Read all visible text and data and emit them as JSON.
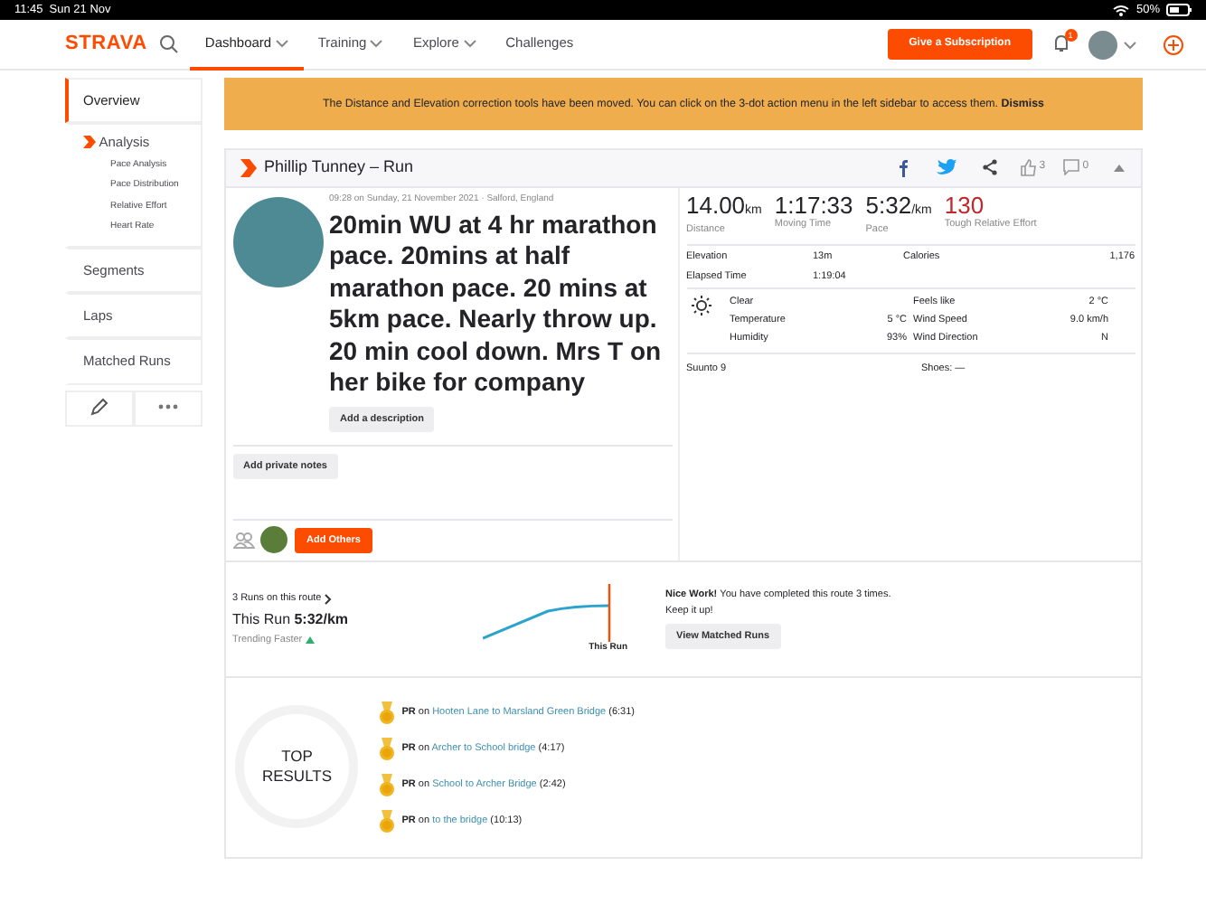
{
  "status_bar": {
    "time": "11:45",
    "date": "Sun 21 Nov",
    "battery": "50%"
  },
  "navbar": {
    "logo": "STRAVA",
    "tabs": [
      {
        "label": "Dashboard",
        "selected": true,
        "dropdown": true
      },
      {
        "label": "Training",
        "selected": false,
        "dropdown": true
      },
      {
        "label": "Explore",
        "selected": false,
        "dropdown": true
      },
      {
        "label": "Challenges",
        "selected": false,
        "dropdown": false
      }
    ],
    "subscribe_button": "Give a Subscription",
    "notification_count": "1"
  },
  "sidebar": {
    "items": [
      {
        "label": "Overview",
        "selected": true
      },
      {
        "label": "Analysis",
        "selected": false,
        "expanded": true,
        "children": [
          {
            "label": "Pace Analysis"
          },
          {
            "label": "Pace Distribution"
          },
          {
            "label": "Relative Effort"
          },
          {
            "label": "Heart Rate"
          }
        ]
      },
      {
        "label": "Segments",
        "selected": false
      },
      {
        "label": "Laps",
        "selected": false
      },
      {
        "label": "Matched Runs",
        "selected": false
      }
    ]
  },
  "banner": {
    "message": "The Distance and Elevation correction tools have been moved. You can click on the 3-dot action menu in the left sidebar to access them.",
    "action": "Dismiss"
  },
  "activity": {
    "title": "Phillip Tunney – Run",
    "kudos": "3",
    "comments": "0",
    "meta": "09:28 on Sunday, 21 November 2021 · Salford, England",
    "name": "20min WU at 4 hr marathon pace. 20mins at half marathon pace. 20 mins at 5km pace. Nearly throw up. 20 min cool down. Mrs T on her bike for company",
    "description_button": "Add a description",
    "notes_button": "Add private notes",
    "add_others_button": "Add Others",
    "stats": [
      {
        "value": "14.00",
        "unit": "km",
        "label": "Distance",
        "emphasis": false
      },
      {
        "value": "1:17:33",
        "label": "Moving Time",
        "emphasis": false
      },
      {
        "value": "5:32",
        "unit": "/km",
        "label": "Pace",
        "emphasis": false
      },
      {
        "value": "130",
        "label": "Tough Relative Effort",
        "emphasis": true
      }
    ],
    "details": [
      {
        "label": "Elevation",
        "value": "13m"
      },
      {
        "label": "Calories",
        "value": "1,176"
      },
      {
        "label": "Elapsed Time",
        "value": "1:19:04"
      }
    ],
    "weather": {
      "condition": "Clear",
      "left": [
        {
          "label": "Temperature",
          "value": "5 °C"
        },
        {
          "label": "Humidity",
          "value": "93%"
        }
      ],
      "right": [
        {
          "label": "Feels like",
          "value": "2 °C"
        },
        {
          "label": "Wind Speed",
          "value": "9.0 km/h"
        },
        {
          "label": "Wind Direction",
          "value": "N"
        }
      ]
    },
    "device": "Suunto 9",
    "shoes": "Shoes: —"
  },
  "route": {
    "runs_link": "3 Runs on this route",
    "this_run_label": "This Run",
    "this_run_pace": "5:32/km",
    "trend": "Trending Faster",
    "chart_marker": "This Run",
    "message_bold": "Nice Work!",
    "message": "You have completed this route 3 times. Keep it up!",
    "button": "View Matched Runs"
  },
  "top_results": {
    "title": "TOP RESULTS",
    "items": [
      {
        "badge": "PR",
        "connector": "on",
        "segment": "Hooten Lane to Marsland Green Bridge",
        "time": "(6:31)"
      },
      {
        "badge": "PR",
        "connector": "on",
        "segment": "Archer to School bridge",
        "time": "(4:17)"
      },
      {
        "badge": "PR",
        "connector": "on",
        "segment": "School to Archer Bridge",
        "time": "(2:42)"
      },
      {
        "badge": "PR",
        "connector": "on",
        "segment": "to the bridge",
        "time": "(10:13)"
      }
    ]
  }
}
